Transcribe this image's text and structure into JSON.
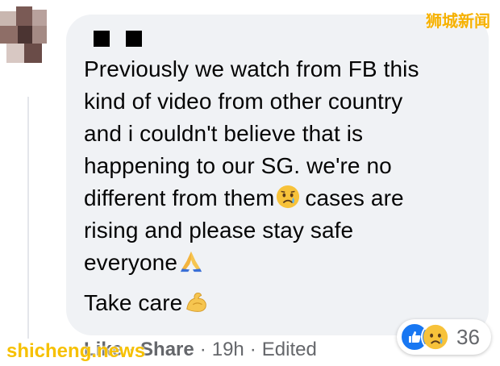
{
  "comment": {
    "lines": [
      "Previously we watch from FB this",
      "kind of video from other country",
      "and i couldn't believe that is",
      "happening to our SG. we're no",
      "different from them",
      "cases are",
      "rising and please stay safe",
      "everyone"
    ],
    "closing": "Take care"
  },
  "emojis": {
    "sad": "sad-face-emoji",
    "pray": "folded-hands-emoji",
    "flex": "flexed-biceps-emoji"
  },
  "reactions": {
    "count": "36",
    "types": [
      "like",
      "sad"
    ],
    "like_color": "#1877f2"
  },
  "actions": {
    "like": "Like",
    "share": "Share",
    "time": "19h",
    "edited": "Edited",
    "separator": "·"
  },
  "watermarks": {
    "top": "狮城新闻",
    "bottom": "shicheng.news"
  }
}
